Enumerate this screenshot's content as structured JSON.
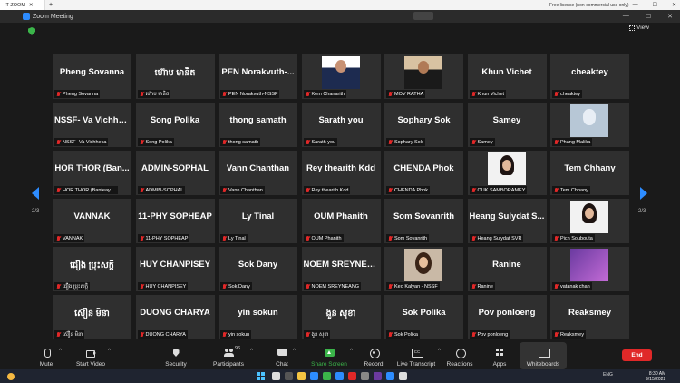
{
  "os": {
    "tab_title": "IT-ZOOM",
    "new_tab": "+",
    "license": "Free license (non-commercial use only)",
    "min": "—",
    "max": "☐",
    "close": "✕"
  },
  "zoom": {
    "window_title": "Zoom Meeting",
    "view_label": "View",
    "page_indicator_left": "2/3",
    "page_indicator_right": "2/3"
  },
  "tiles": [
    {
      "big": "Pheng Sovanna",
      "label": "Pheng Sovanna"
    },
    {
      "big": "ហ៊ោប មានិត",
      "label": "ហ៊ោប មានិត"
    },
    {
      "big": "PEN Norakvuth-...",
      "label": "PEN Norakvuth-NSSF"
    },
    {
      "big": "",
      "label": "Kem Chanarith",
      "photo": "formal"
    },
    {
      "big": "",
      "label": "MOV RATHA",
      "photo": "dark"
    },
    {
      "big": "Khun Vichet",
      "label": "Khun Vichet"
    },
    {
      "big": "cheaktey",
      "label": "cheaktey"
    },
    {
      "big": "NSSF- Va Vichhe...",
      "label": "NSSF- Va Vichheka"
    },
    {
      "big": "Song Polika",
      "label": "Song Polika"
    },
    {
      "big": "thong samath",
      "label": "thong samath"
    },
    {
      "big": "Sarath you",
      "label": "Sarath you"
    },
    {
      "big": "Sophary Sok",
      "label": "Sophary Sok"
    },
    {
      "big": "Samey",
      "label": "Samey"
    },
    {
      "big": "",
      "label": "Phang Malika",
      "photo": "mask"
    },
    {
      "big": "HOR THOR (Ban...",
      "label": "HOR THOR (Banteay ..."
    },
    {
      "big": "ADMIN-SOPHAL",
      "label": "ADMIN-SOPHAL"
    },
    {
      "big": "Vann Chanthan",
      "label": "Vann Chanthan"
    },
    {
      "big": "Rey thearith Kdd",
      "label": "Rey thearith Kdd"
    },
    {
      "big": "CHENDA Phok",
      "label": "CHENDA Phok"
    },
    {
      "big": "",
      "label": "OUK SAMBORAMEY",
      "photo": "girl"
    },
    {
      "big": "Tem Chhany",
      "label": "Tem Chhany"
    },
    {
      "big": "VANNAK",
      "label": "VANNAK"
    },
    {
      "big": "11-PHY SOPHEAP",
      "label": "11-PHY SOPHEAP"
    },
    {
      "big": "Ly Tinal",
      "label": "Ly Tinal"
    },
    {
      "big": "OUM Phanith",
      "label": "OUM Phanith"
    },
    {
      "big": "Som Sovanrith",
      "label": "Som Sovanrith"
    },
    {
      "big": "Heang Sulydat S...",
      "label": "Heang Sulydat SVR"
    },
    {
      "big": "",
      "label": "Pich Soubouta",
      "photo": "girl"
    },
    {
      "big": "ជឿង ប្រុះសក្តិ",
      "label": "ជឿង ប្រុះសក្តិ"
    },
    {
      "big": "HUY CHANPISEY",
      "label": "HUY CHANPISEY"
    },
    {
      "big": "Sok Dany",
      "label": "Sok Dany"
    },
    {
      "big": "NOEM SREYNEA...",
      "label": "NOEM SREYNEANG"
    },
    {
      "big": "",
      "label": "Keo Kalyan - NSSF",
      "photo": "woman"
    },
    {
      "big": "Ranine",
      "label": "Ranine"
    },
    {
      "big": "",
      "label": "vatanak chan",
      "photo": "purple"
    },
    {
      "big": "ស៊ឿន មិនា",
      "label": "ស៊ឿន មិនា"
    },
    {
      "big": "DUONG CHARYA",
      "label": "DUONG CHARYA"
    },
    {
      "big": "yin sokun",
      "label": "yin sokun"
    },
    {
      "big": "ងួន សុខា",
      "label": "ងួន សុខា"
    },
    {
      "big": "Sok Polika",
      "label": "Sok Polika"
    },
    {
      "big": "Pov ponloeng",
      "label": "Pov ponloeng"
    },
    {
      "big": "Reaksmey",
      "label": "Reaksmey"
    }
  ],
  "toolbar": {
    "mute": "Mute",
    "start_video": "Start Video",
    "security": "Security",
    "participants": "Participants",
    "participants_count": "96",
    "chat": "Chat",
    "share_screen": "Share Screen",
    "record": "Record",
    "live_transcript": "Live Transcript",
    "reactions": "Reactions",
    "apps": "Apps",
    "whiteboards": "Whiteboards",
    "end": "End"
  },
  "taskbar": {
    "lang": "ENG",
    "time": "8:30 AM",
    "date": "9/15/2022"
  },
  "colors": {
    "accent": "#2d8cff",
    "end": "#e02828",
    "share": "#3bb54a"
  }
}
